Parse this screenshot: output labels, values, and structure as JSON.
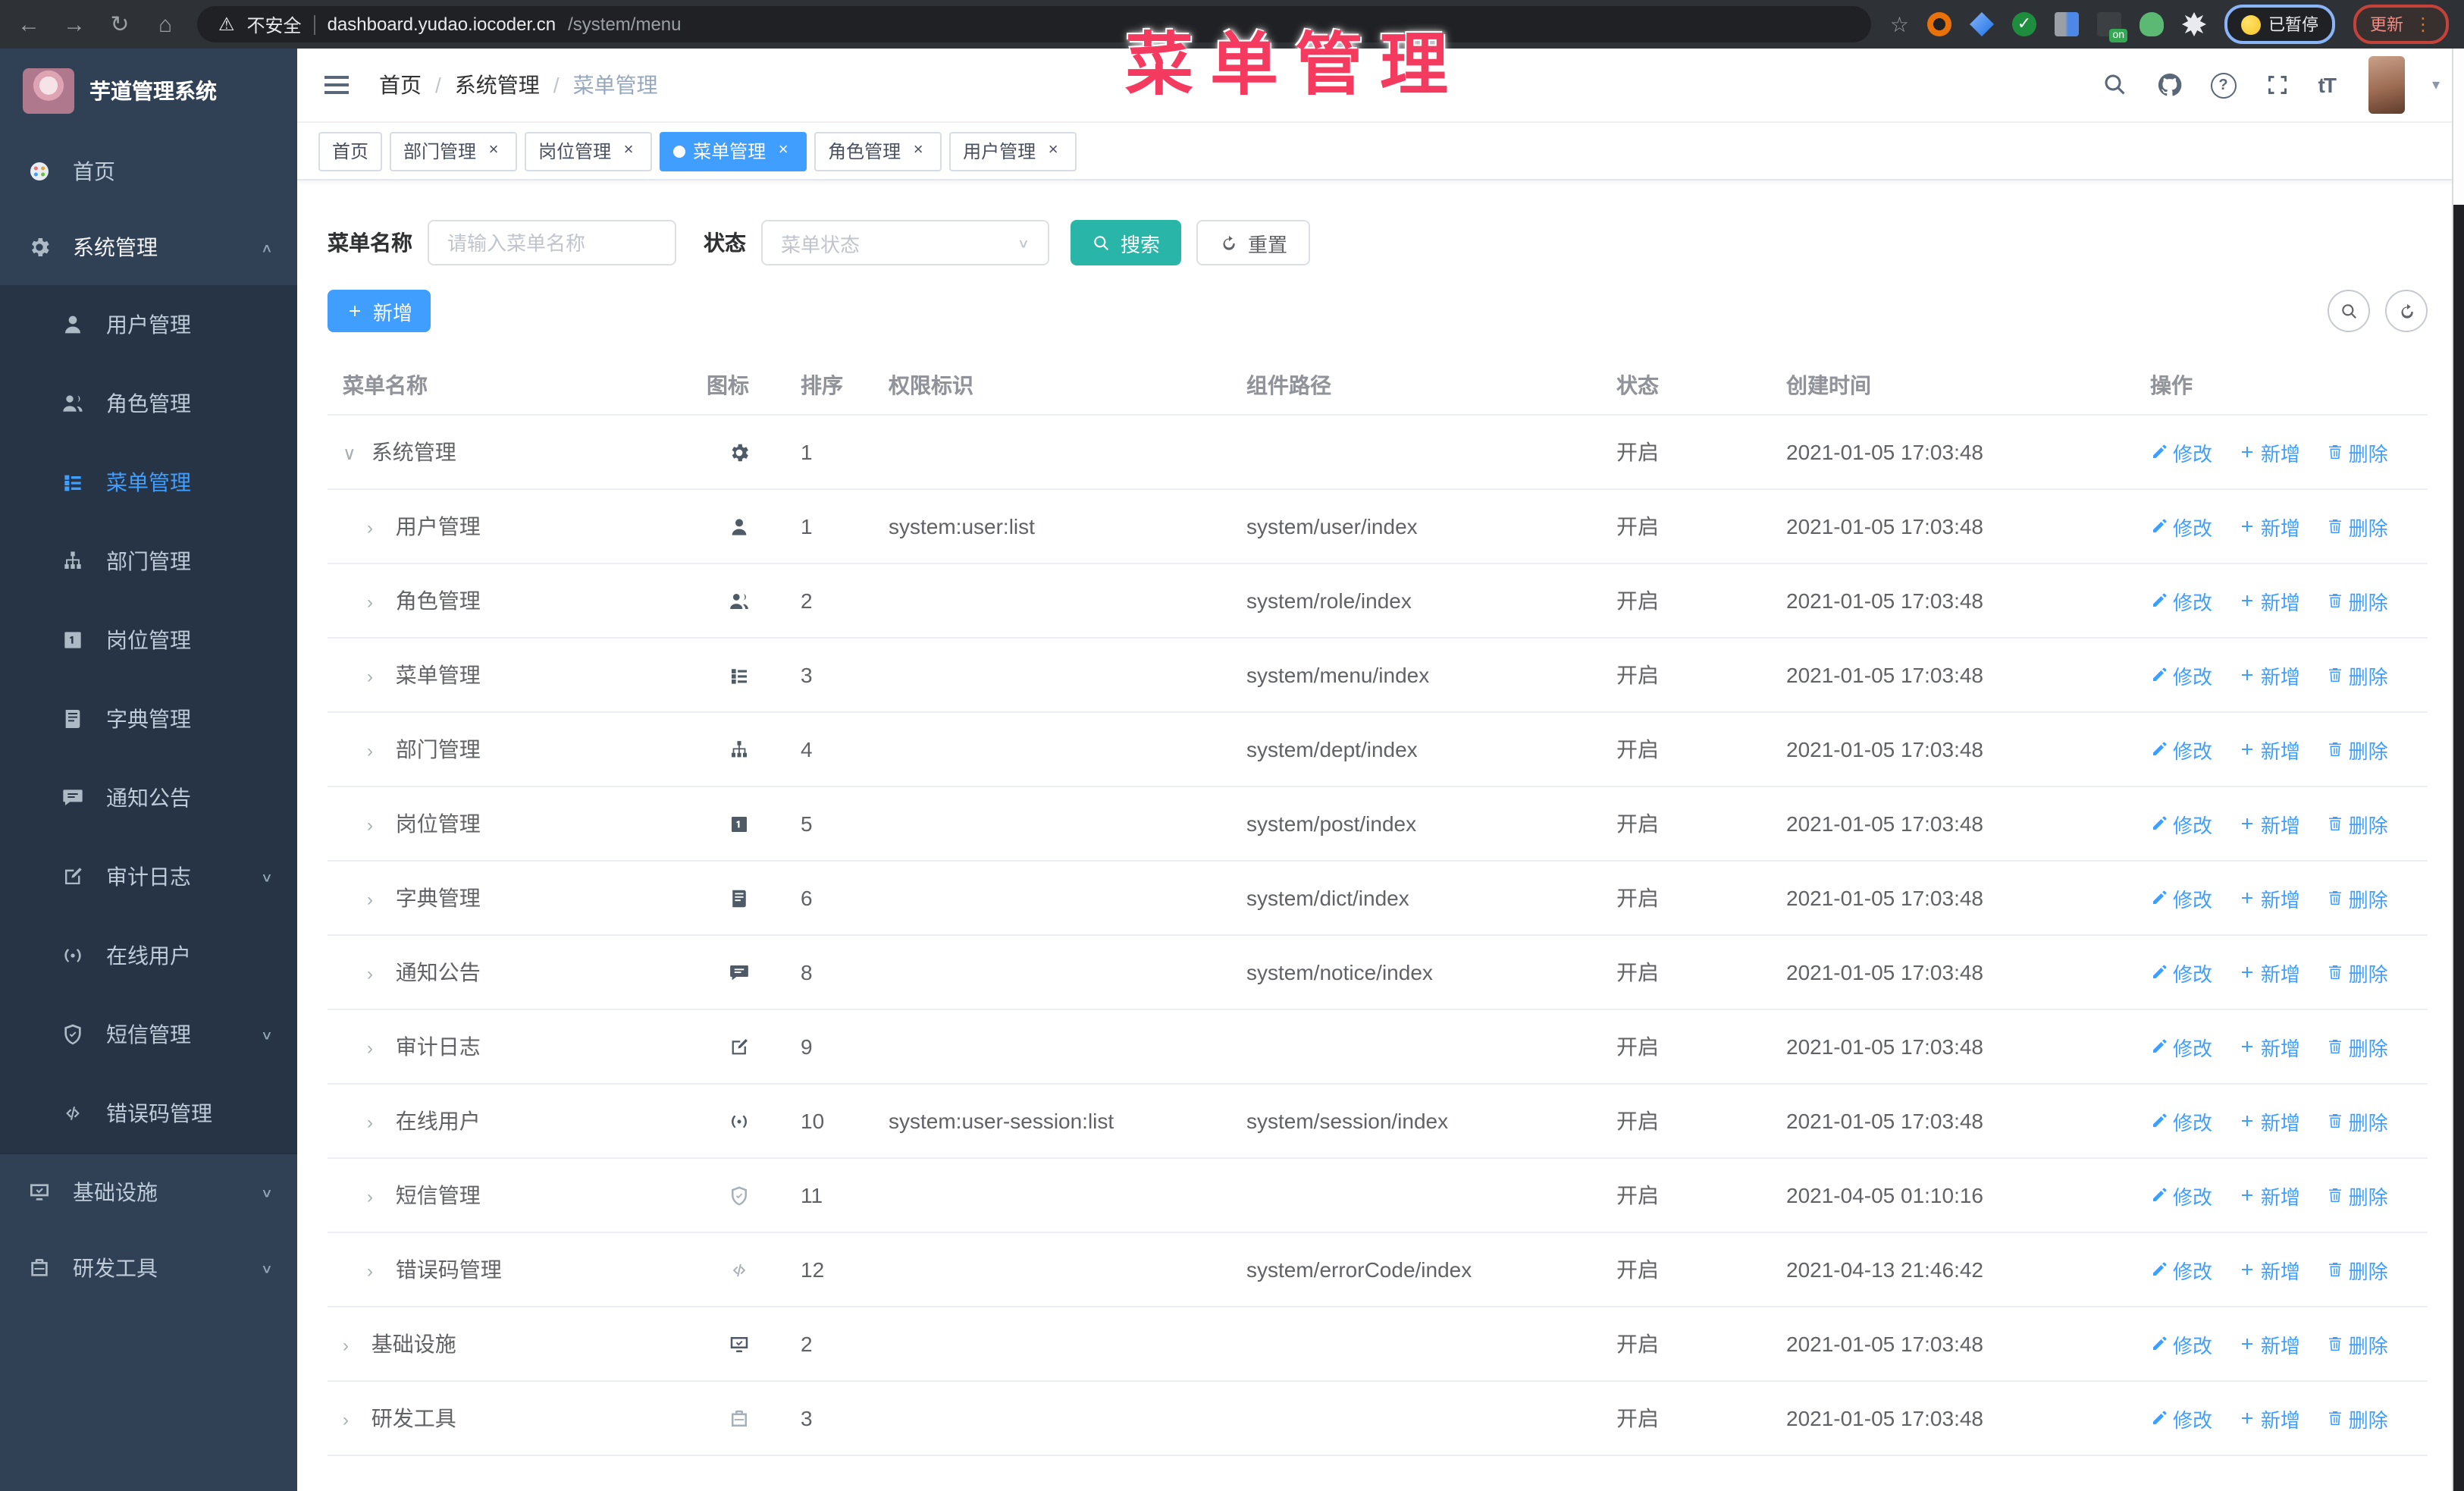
{
  "browser": {
    "security_label": "不安全",
    "url_host": "dashboard.yudao.iocoder.cn",
    "url_path": "/system/menu",
    "paused_chip": "已暂停",
    "update_button": "更新",
    "nav_icons": [
      "back",
      "forward",
      "reload",
      "home"
    ],
    "extension_icons": [
      "bookmark-star",
      "orange-ring",
      "blue-gem",
      "green-check",
      "grid",
      "on-badge",
      "green-animal",
      "puzzle"
    ]
  },
  "overlay_title": "菜单管理",
  "colors": {
    "accent_blue": "#409eff",
    "search_teal": "#29b6a8",
    "overlay_red": "#f43b5f",
    "sidebar_bg": "#304156",
    "submenu_bg": "#263445",
    "active_tag_bg": "#409eff"
  },
  "sidebar": {
    "logo_title": "芋道管理系统",
    "items": [
      {
        "label": "首页",
        "icon": "home",
        "type": "top"
      },
      {
        "label": "系统管理",
        "icon": "gear",
        "type": "top",
        "expanded": true,
        "chevron": "up"
      },
      {
        "label": "用户管理",
        "icon": "user",
        "type": "sub"
      },
      {
        "label": "角色管理",
        "icon": "users",
        "type": "sub"
      },
      {
        "label": "菜单管理",
        "icon": "list",
        "type": "sub",
        "active": true
      },
      {
        "label": "部门管理",
        "icon": "tree",
        "type": "sub"
      },
      {
        "label": "岗位管理",
        "icon": "badge",
        "type": "sub"
      },
      {
        "label": "字典管理",
        "icon": "book",
        "type": "sub"
      },
      {
        "label": "通知公告",
        "icon": "chat",
        "type": "sub"
      },
      {
        "label": "审计日志",
        "icon": "edit",
        "type": "sub",
        "chevron": "down"
      },
      {
        "label": "在线用户",
        "icon": "online",
        "type": "sub"
      },
      {
        "label": "短信管理",
        "icon": "shield",
        "type": "sub",
        "chevron": "down"
      },
      {
        "label": "错误码管理",
        "icon": "code",
        "type": "sub"
      },
      {
        "label": "基础设施",
        "icon": "monitor",
        "type": "top",
        "chevron": "down",
        "divided": true
      },
      {
        "label": "研发工具",
        "icon": "tool",
        "type": "top",
        "chevron": "down"
      }
    ]
  },
  "header": {
    "breadcrumb": [
      "首页",
      "系统管理",
      "菜单管理"
    ],
    "icon_names": [
      "search-icon",
      "github-icon",
      "help-icon",
      "fullscreen-icon",
      "font-size-icon",
      "avatar",
      "caret-down-icon"
    ]
  },
  "tags": [
    {
      "label": "首页",
      "closable": false,
      "active": false
    },
    {
      "label": "部门管理",
      "closable": true,
      "active": false
    },
    {
      "label": "岗位管理",
      "closable": true,
      "active": false
    },
    {
      "label": "菜单管理",
      "closable": true,
      "active": true
    },
    {
      "label": "角色管理",
      "closable": true,
      "active": false
    },
    {
      "label": "用户管理",
      "closable": true,
      "active": false
    }
  ],
  "filters": {
    "name_label": "菜单名称",
    "name_placeholder": "请输入菜单名称",
    "status_label": "状态",
    "status_placeholder": "菜单状态",
    "search_label": "搜索",
    "reset_label": "重置"
  },
  "toolbar": {
    "add_label": "新增"
  },
  "table": {
    "columns": [
      "菜单名称",
      "图标",
      "排序",
      "权限标识",
      "组件路径",
      "状态",
      "创建时间",
      "操作"
    ],
    "actions": {
      "edit": "修改",
      "add": "新增",
      "delete": "删除"
    },
    "rows": [
      {
        "name": "系统管理",
        "level": 0,
        "expanded": true,
        "icon": "gear",
        "sort": "1",
        "perm": "",
        "path": "",
        "status": "开启",
        "time": "2021-01-05 17:03:48"
      },
      {
        "name": "用户管理",
        "level": 1,
        "icon": "user",
        "sort": "1",
        "perm": "system:user:list",
        "path": "system/user/index",
        "status": "开启",
        "time": "2021-01-05 17:03:48"
      },
      {
        "name": "角色管理",
        "level": 1,
        "icon": "users",
        "sort": "2",
        "perm": "",
        "path": "system/role/index",
        "status": "开启",
        "time": "2021-01-05 17:03:48"
      },
      {
        "name": "菜单管理",
        "level": 1,
        "icon": "list",
        "sort": "3",
        "perm": "",
        "path": "system/menu/index",
        "status": "开启",
        "time": "2021-01-05 17:03:48"
      },
      {
        "name": "部门管理",
        "level": 1,
        "icon": "tree",
        "sort": "4",
        "perm": "",
        "path": "system/dept/index",
        "status": "开启",
        "time": "2021-01-05 17:03:48"
      },
      {
        "name": "岗位管理",
        "level": 1,
        "icon": "badge",
        "sort": "5",
        "perm": "",
        "path": "system/post/index",
        "status": "开启",
        "time": "2021-01-05 17:03:48"
      },
      {
        "name": "字典管理",
        "level": 1,
        "icon": "book",
        "sort": "6",
        "perm": "",
        "path": "system/dict/index",
        "status": "开启",
        "time": "2021-01-05 17:03:48"
      },
      {
        "name": "通知公告",
        "level": 1,
        "icon": "chat",
        "sort": "8",
        "perm": "",
        "path": "system/notice/index",
        "status": "开启",
        "time": "2021-01-05 17:03:48"
      },
      {
        "name": "审计日志",
        "level": 1,
        "icon": "edit",
        "sort": "9",
        "perm": "",
        "path": "",
        "status": "开启",
        "time": "2021-01-05 17:03:48"
      },
      {
        "name": "在线用户",
        "level": 1,
        "icon": "online",
        "sort": "10",
        "perm": "system:user-session:list",
        "path": "system/session/index",
        "status": "开启",
        "time": "2021-01-05 17:03:48"
      },
      {
        "name": "短信管理",
        "level": 1,
        "icon": "shield",
        "light": true,
        "sort": "11",
        "perm": "",
        "path": "",
        "status": "开启",
        "time": "2021-04-05 01:10:16"
      },
      {
        "name": "错误码管理",
        "level": 1,
        "icon": "code",
        "light": true,
        "sort": "12",
        "perm": "",
        "path": "system/errorCode/index",
        "status": "开启",
        "time": "2021-04-13 21:46:42"
      },
      {
        "name": "基础设施",
        "level": 0,
        "icon": "monitor",
        "sort": "2",
        "perm": "",
        "path": "",
        "status": "开启",
        "time": "2021-01-05 17:03:48"
      },
      {
        "name": "研发工具",
        "level": 0,
        "icon": "tool",
        "light": true,
        "sort": "3",
        "perm": "",
        "path": "",
        "status": "开启",
        "time": "2021-01-05 17:03:48"
      }
    ]
  }
}
